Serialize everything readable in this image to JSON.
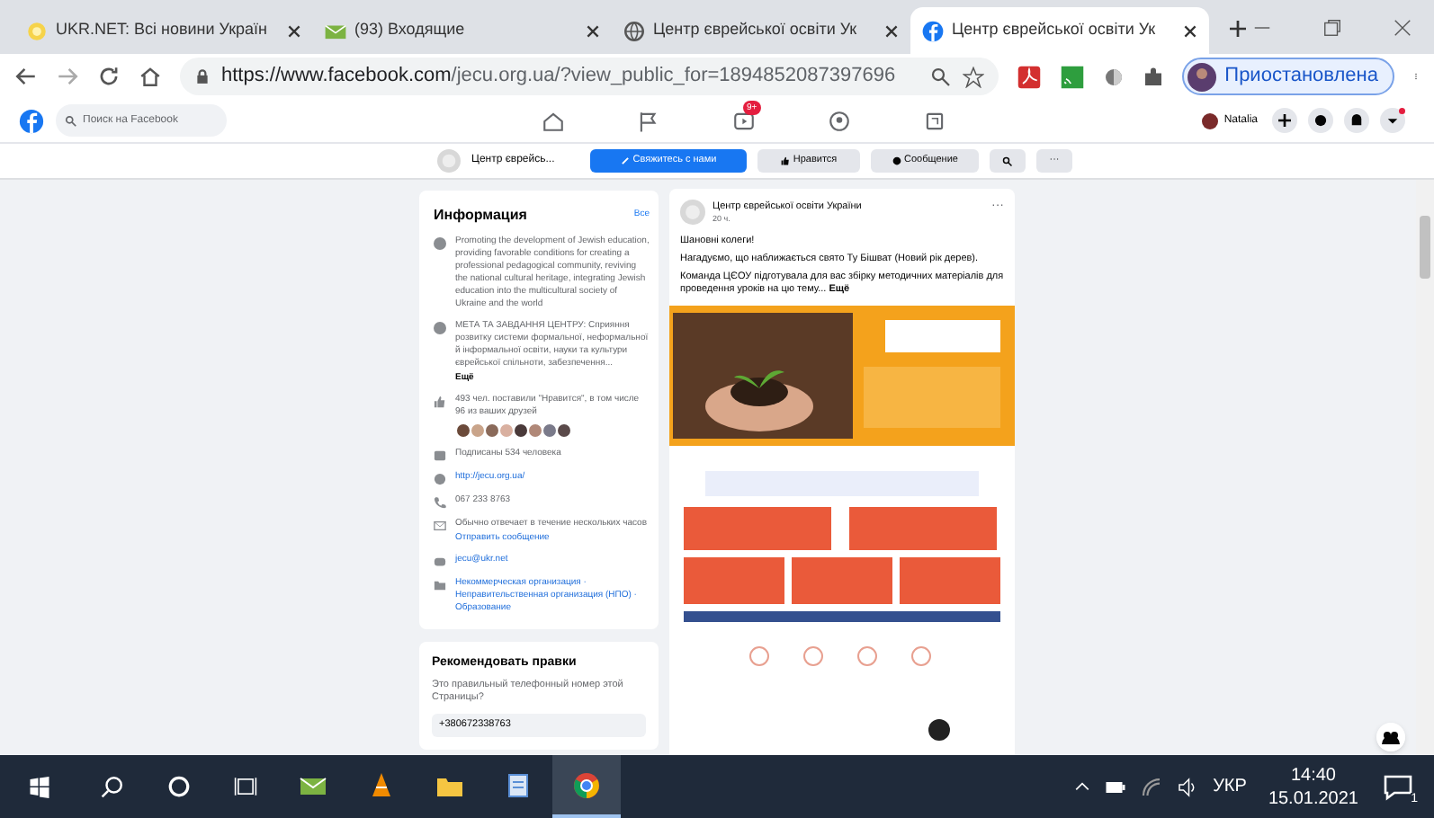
{
  "browser": {
    "tabs": [
      {
        "title": "UKR.NET: Всі новини Україн",
        "selected": false
      },
      {
        "title": "(93) Входящие",
        "selected": false
      },
      {
        "title": "Центр єврейської освіти Ук",
        "selected": false
      },
      {
        "title": "Центр єврейської освіти Ук",
        "selected": true
      }
    ],
    "url_host": "https://www.facebook.com",
    "url_path": "/jecu.org.ua/?view_public_for=1894852087397696",
    "profile": "Приостановлена"
  },
  "facebook_header": {
    "search_placeholder": "Поиск на Facebook",
    "video_badge": "9+",
    "user": "Natalia"
  },
  "page_bar": {
    "page_name": "Центр єврейсь...",
    "buttons": [
      {
        "kind": "primary",
        "label": "Свяжитесь с нами"
      },
      {
        "kind": "like",
        "label": "Нравится"
      },
      {
        "kind": "message",
        "label": "Сообщение"
      },
      {
        "kind": "search"
      },
      {
        "kind": "more",
        "label": "···"
      }
    ]
  },
  "info": {
    "title": "Информация",
    "link": "Все",
    "items": [
      {
        "kind": "about",
        "text": "Promoting the development of Jewish education, providing favorable conditions for creating a professional pedagogical community, reviving the national cultural heritage, integrating Jewish education into the multicultural society of Ukraine and the world"
      },
      {
        "kind": "about",
        "text": "МЕТА ТА ЗАВДАННЯ ЦЕНТРУ: Сприяння розвитку системи формальної, неформальної й інформальної освіти, науки та культури єврейської спільноти, забезпечення...",
        "more": "Ещё"
      },
      {
        "kind": "likes",
        "text": "493 чел. поставили \"Нравится\", в том числе 96 из ваших друзей"
      },
      {
        "kind": "followers",
        "text": "Подписаны 534 человека"
      },
      {
        "kind": "website",
        "text": "http://jecu.org.ua/"
      },
      {
        "kind": "phone",
        "text": "067 233 8763"
      },
      {
        "kind": "response",
        "text": "Обычно отвечает в течение нескольких часов",
        "more_link": "Отправить сообщение"
      },
      {
        "kind": "email",
        "text": "jecu@ukr.net"
      },
      {
        "kind": "category",
        "text": "Некоммерческая организация · Неправительственная организация (НПО) · Образование"
      }
    ]
  },
  "recommend": {
    "title": "Рекомендовать правки",
    "question": "Это правильный телефонный номер этой Страницы?",
    "value": "+380672338763"
  },
  "post": {
    "author": "Центр єврейської освіти України",
    "time": "20 ч.",
    "more": "···",
    "paragraphs": [
      "Шановні колеги!",
      "Нагадуємо, що наближається свято Ту Бішват (Новий рік дерев).",
      "Команда ЦЄОУ підготувала для вас збірку методичних матеріалів для проведення уроків на цю тему... **Ещё**"
    ],
    "image": {
      "kind": "picture"
    }
  },
  "taskbar": {
    "apps": [
      {
        "selected": false
      },
      {
        "selected": false
      },
      {
        "selected": false
      },
      {
        "selected": false
      },
      {
        "selected": true
      }
    ],
    "language": "УКР",
    "time": "14:40",
    "date": "15.01.2021",
    "notifications": "1"
  }
}
